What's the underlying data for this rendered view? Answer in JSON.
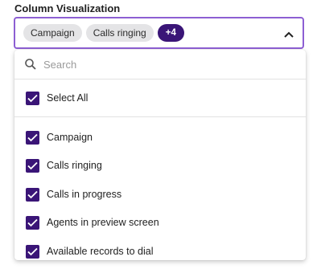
{
  "field": {
    "label": "Column Visualization"
  },
  "select": {
    "chips": [
      "Campaign",
      "Calls ringing"
    ],
    "more_count": "+4"
  },
  "search": {
    "placeholder": "Search",
    "value": ""
  },
  "select_all": {
    "label": "Select All",
    "checked": true
  },
  "options": [
    {
      "label": "Campaign",
      "checked": true
    },
    {
      "label": "Calls ringing",
      "checked": true
    },
    {
      "label": "Calls in progress",
      "checked": true
    },
    {
      "label": "Agents in preview screen",
      "checked": true
    },
    {
      "label": "Available records to dial",
      "checked": true
    }
  ],
  "colors": {
    "accent": "#3a1577",
    "focus_border": "#8d5fd3",
    "chip_bg": "#e4e4e6"
  },
  "icons": {
    "search": "search-icon",
    "chevron": "chevron-up-icon",
    "check": "check-icon"
  }
}
